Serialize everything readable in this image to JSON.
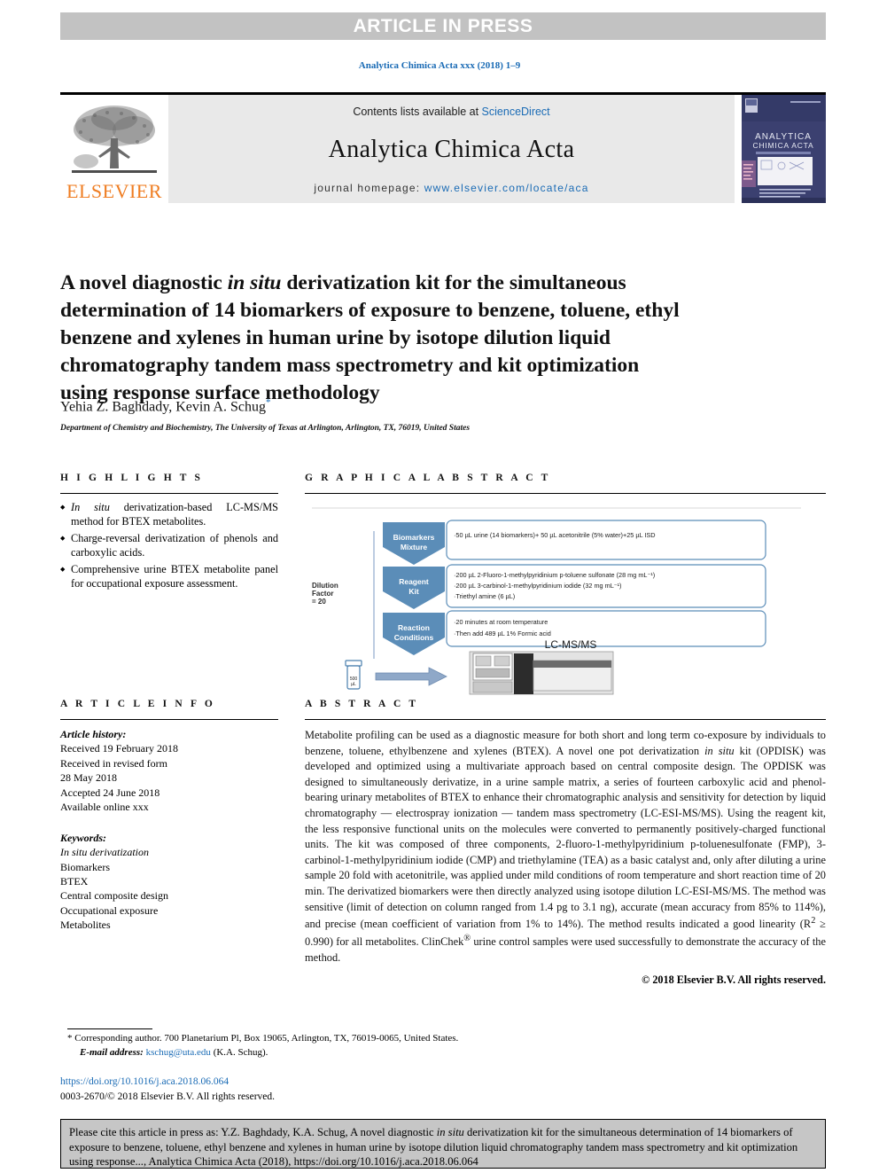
{
  "banner": {
    "text": "ARTICLE IN PRESS"
  },
  "running_head": "Analytica Chimica Acta xxx (2018) 1–9",
  "masthead": {
    "contents_prefix": "Contents lists available at ",
    "contents_link": "ScienceDirect",
    "journal_name": "Analytica Chimica Acta",
    "homepage_prefix": "journal homepage: ",
    "homepage_url": "www.elsevier.com/locate/aca",
    "publisher": "ELSEVIER",
    "cover": {
      "title_line1": "ANALYTICA",
      "title_line2": "CHIMICA ACTA",
      "bg_color": "#3b4070",
      "accent_color": "#7d5a8c"
    }
  },
  "article": {
    "title_part1": "A novel diagnostic ",
    "title_italic": "in situ",
    "title_part2": " derivatization kit for the simultaneous determination of 14 biomarkers of exposure to benzene, toluene, ethyl benzene and xylenes in human urine by isotope dilution liquid chromatography tandem mass spectrometry and kit optimization using response surface methodology",
    "authors": "Yehia Z. Baghdady, Kevin A. Schug",
    "corresponding_marker": "*",
    "affiliation": "Department of Chemistry and Biochemistry, The University of Texas at Arlington, Arlington, TX, 76019, United States"
  },
  "highlights": {
    "heading": "H I G H L I G H T S",
    "items": [
      {
        "pre": "",
        "italic": "In situ",
        "post": " derivatization-based LC-MS/MS method for BTEX metabolites."
      },
      {
        "pre": "Charge-reversal derivatization of phenols and carboxylic acids.",
        "italic": "",
        "post": ""
      },
      {
        "pre": "Comprehensive urine BTEX metabolite panel for occupational exposure assessment.",
        "italic": "",
        "post": ""
      }
    ]
  },
  "graphical_abstract": {
    "heading": "G R A P H I C A L   A B S T R A C T",
    "dilution_label_line1": "Dilution",
    "dilution_label_line2": "Factor",
    "dilution_label_line3": "= 20",
    "steps": [
      {
        "label_line1": "Biomarkers",
        "label_line2": "Mixture",
        "lines": [
          "·50 µL urine (14 biomarkers)+ 50 µL acetonitrile (5% water)+25 µL ISD"
        ]
      },
      {
        "label_line1": "Reagent",
        "label_line2": "Kit",
        "lines": [
          "·200 µL 2-Fluoro-1-methylpyridinium p-toluene sulfonate (28 mg mL⁻¹)",
          "·200 µL 3-carbinol-1-methylpyridinium iodide (32 mg mL⁻¹)",
          "·Triethyl amine (6 µL)"
        ]
      },
      {
        "label_line1": "Reaction",
        "label_line2": "Conditions",
        "lines": [
          "·20 minutes at room temperature",
          "·Then add 489 µL 1% Formic acid"
        ]
      }
    ],
    "instrument_label": "LC-MS/MS",
    "vial_label": "500 µL"
  },
  "article_info": {
    "heading": "A R T I C L E   I N F O",
    "history_label": "Article history:",
    "history_lines": [
      "Received 19 February 2018",
      "Received in revised form",
      "28 May 2018",
      "Accepted 24 June 2018",
      "Available online xxx"
    ],
    "keywords_label": "Keywords:",
    "keywords": [
      "In situ derivatization",
      "Biomarkers",
      "BTEX",
      "Central composite design",
      "Occupational exposure",
      "Metabolites"
    ]
  },
  "abstract": {
    "heading": "A B S T R A C T",
    "paragraph_1": "Metabolite profiling can be used as a diagnostic measure for both short and long term co-exposure by individuals to benzene, toluene, ethylbenzene and xylenes (BTEX). A novel one pot derivatization ",
    "paragraph_italic": "in situ",
    "paragraph_2": " kit (OPDISK) was developed and optimized using a multivariate approach based on central composite design. The OPDISK was designed to simultaneously derivatize, in a urine sample matrix, a series of fourteen carboxylic acid and phenol-bearing urinary metabolites of BTEX to enhance their chromatographic analysis and sensitivity for detection by liquid chromatography — electrospray ionization — tandem mass spectrometry (LC-ESI-MS/MS). Using the reagent kit, the less responsive functional units on the molecules were converted to permanently positively-charged functional units. The kit was composed of three components, 2-fluoro-1-methylpyridinium p-toluenesulfonate (FMP), 3-carbinol-1-methylpyridinium iodide (CMP) and triethylamine (TEA) as a basic catalyst and, only after diluting a urine sample 20 fold with acetonitrile, was applied under mild conditions of room temperature and short reaction time of 20 min. The derivatized biomarkers were then directly analyzed using isotope dilution LC-ESI-MS/MS. The method was sensitive (limit of detection on column ranged from 1.4 pg to 3.1 ng), accurate (mean accuracy from 85% to 114%), and precise (mean coefficient of variation from 1% to 14%). The method results indicated a good linearity (R",
    "r_squared_sup": "2",
    "paragraph_3": " ≥ 0.990) for all metabolites. ClinChek",
    "registered_sup": "®",
    "paragraph_4": " urine control samples were used successfully to demonstrate the accuracy of the method.",
    "copyright": "© 2018 Elsevier B.V. All rights reserved."
  },
  "footnotes": {
    "corresponding_star": "*",
    "corresponding_text": "Corresponding author. 700 Planetarium Pl, Box 19065, Arlington, TX, 76019-0065, United States.",
    "email_label": "E-mail address:",
    "email": "kschug@uta.edu",
    "email_suffix": " (K.A. Schug).",
    "doi": "https://doi.org/10.1016/j.aca.2018.06.064",
    "issn_line": "0003-2670/© 2018 Elsevier B.V. All rights reserved."
  },
  "citation_box": {
    "part1": "Please cite this article in press as: Y.Z. Baghdady, K.A. Schug, A novel diagnostic ",
    "italic": "in situ",
    "part2": " derivatization kit for the simultaneous determination of 14 biomarkers of exposure to benzene, toluene, ethyl benzene and xylenes in human urine by isotope dilution liquid chromatography tandem mass spectrometry and kit optimization using response..., Analytica Chimica Acta (2018), https://doi.org/10.1016/j.aca.2018.06.064"
  }
}
